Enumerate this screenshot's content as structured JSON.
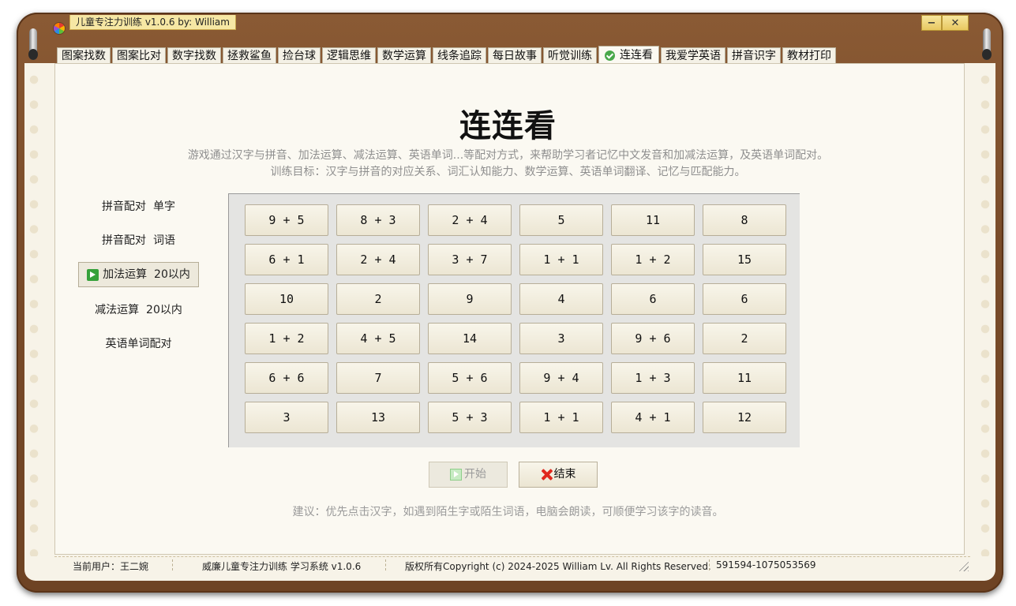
{
  "window": {
    "title": "儿童专注力训练 v1.0.6 by: William",
    "minimize_label": "−",
    "close_label": "✕"
  },
  "tabs": [
    {
      "label": "图案找数"
    },
    {
      "label": "图案比对"
    },
    {
      "label": "数字找数"
    },
    {
      "label": "拯救鲨鱼"
    },
    {
      "label": "捡台球"
    },
    {
      "label": "逻辑思维"
    },
    {
      "label": "数学运算"
    },
    {
      "label": "线条追踪"
    },
    {
      "label": "每日故事"
    },
    {
      "label": "听觉训练"
    },
    {
      "label": "连连看",
      "active": true
    },
    {
      "label": "我爱学英语"
    },
    {
      "label": "拼音识字"
    },
    {
      "label": "教材打印"
    }
  ],
  "page": {
    "title": "连连看",
    "description": "游戏通过汉字与拼音、加法运算、减法运算、英语单词...等配对方式，来帮助学习者记忆中文发音和加减法运算，及英语单词配对。",
    "goal": "训练目标：汉字与拼音的对应关系、词汇认知能力、数学运算、英语单词翻译、记忆与匹配能力。",
    "hint": "建议：优先点击汉字，如遇到陌生字或陌生词语，电脑会朗读，可顺便学习该字的读音。"
  },
  "modes": [
    {
      "label": "拼音配对  单字"
    },
    {
      "label": "拼音配对  词语"
    },
    {
      "label": "加法运算  20以内",
      "active": true,
      "icon": "arrow-right-icon"
    },
    {
      "label": "减法运算  20以内"
    },
    {
      "label": "英语单词配对"
    }
  ],
  "board": {
    "rows": [
      [
        "9 + 5",
        "8 + 3",
        "2 + 4",
        "5",
        "11",
        "8"
      ],
      [
        "6 + 1",
        "2 + 4",
        "3 + 7",
        "1 + 1",
        "1 + 2",
        "15"
      ],
      [
        "10",
        "2",
        "9",
        "4",
        "6",
        "6"
      ],
      [
        "1 + 2",
        "4 + 5",
        "14",
        "3",
        "9 + 6",
        "2"
      ],
      [
        "6 + 6",
        "7",
        "5 + 6",
        "9 + 4",
        "1 + 3",
        "11"
      ],
      [
        "3",
        "13",
        "5 + 3",
        "1 + 1",
        "4 + 1",
        "12"
      ]
    ]
  },
  "buttons": {
    "start": "开始",
    "end": "结束"
  },
  "statusbar": {
    "user": "当前用户：王二婉",
    "system": "威廉儿童专注力训练 学习系统 v1.0.6",
    "copyright": "版权所有Copyright (c) 2024-2025 William Lv. All Rights Reserved.",
    "contact": "591594-1075053569"
  }
}
